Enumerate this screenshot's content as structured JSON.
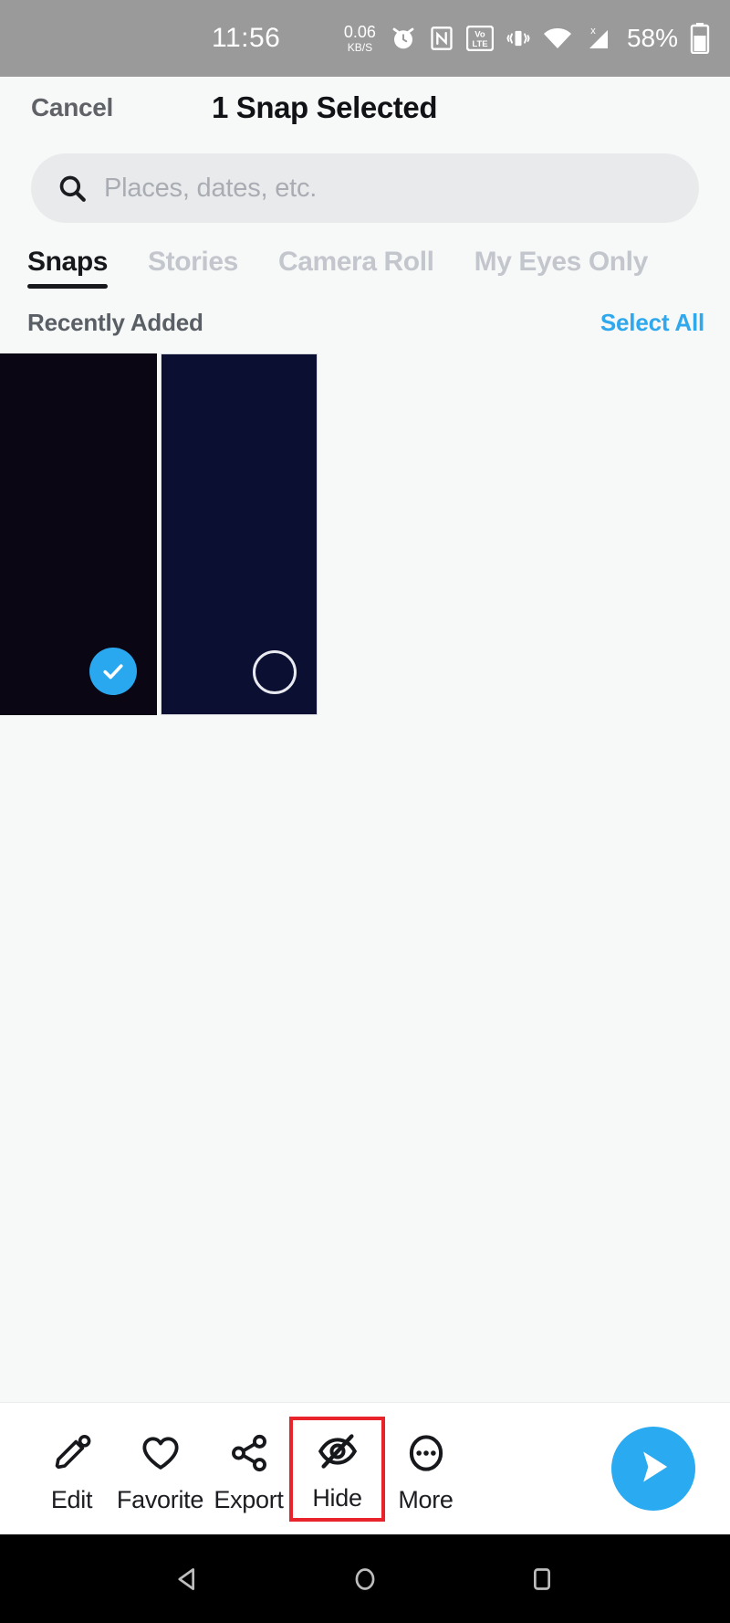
{
  "status_bar": {
    "time": "11:56",
    "net_speed_value": "0.06",
    "net_speed_unit": "KB/S",
    "alarm_icon": "alarm-clock-icon",
    "nfc_icon": "nfc-icon",
    "volte_icon": "volte-icon",
    "volte_top": "Vo",
    "volte_bottom": "LTE",
    "vibrate_icon": "vibrate-icon",
    "wifi_icon": "wifi-icon",
    "signal_icon": "cellular-signal-no-sim-icon",
    "signal_badge": "x",
    "battery_percent": "58%",
    "battery_icon": "battery-icon",
    "background_color": "#9a9a9a"
  },
  "header": {
    "cancel_label": "Cancel",
    "title": "1 Snap Selected"
  },
  "search": {
    "placeholder": "Places, dates, etc.",
    "value": "",
    "icon": "search-icon"
  },
  "tabs": [
    {
      "label": "Snaps",
      "active": true
    },
    {
      "label": "Stories",
      "active": false
    },
    {
      "label": "Camera Roll",
      "active": false
    },
    {
      "label": "My Eyes Only",
      "active": false
    }
  ],
  "section": {
    "title": "Recently Added",
    "select_all_label": "Select All",
    "select_all_color": "#2fa8ee"
  },
  "thumbnails": [
    {
      "name": "snap-thumbnail-1",
      "color": "#0a0614",
      "selected": true,
      "check_icon": "check-icon"
    },
    {
      "name": "snap-thumbnail-2",
      "color": "#0b1033",
      "selected": false,
      "check_icon": "circle-outline-icon"
    }
  ],
  "toolbar": {
    "items": [
      {
        "label": "Edit",
        "icon": "pencil-icon",
        "highlighted": false
      },
      {
        "label": "Favorite",
        "icon": "heart-icon",
        "highlighted": false
      },
      {
        "label": "Export",
        "icon": "share-icon",
        "highlighted": false
      },
      {
        "label": "Hide",
        "icon": "eye-slash-icon",
        "highlighted": true
      },
      {
        "label": "More",
        "icon": "ellipsis-circle-icon",
        "highlighted": false
      }
    ],
    "send_icon": "send-arrow-icon",
    "send_color": "#2aaaf0",
    "highlight_color": "#e8232a"
  },
  "nav_bar": {
    "back_icon": "back-triangle-icon",
    "home_icon": "home-circle-icon",
    "recents_icon": "recents-square-icon",
    "background_color": "#000000"
  }
}
